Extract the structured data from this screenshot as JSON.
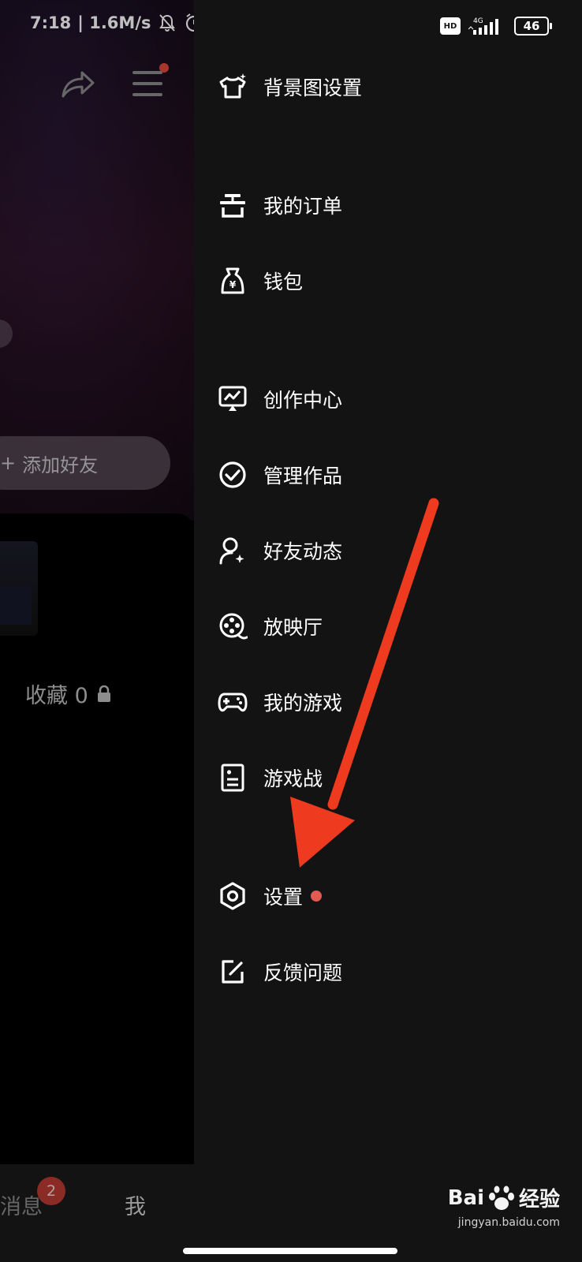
{
  "status_bar": {
    "time": "7:18",
    "net_speed": "| 1.6M/s",
    "network": "4G",
    "hd": "HD",
    "battery": "46"
  },
  "background_page": {
    "add_friend_label": "添加好友",
    "collect_label": "收藏 0",
    "tabbar": {
      "messages_label": "消息",
      "messages_badge": "2",
      "me_label": "我"
    }
  },
  "drawer": {
    "items": [
      {
        "label": "背景图设置",
        "icon": "tshirt-icon"
      },
      {
        "label": "我的订单",
        "icon": "order-icon"
      },
      {
        "label": "钱包",
        "icon": "wallet-icon"
      },
      {
        "label": "创作中心",
        "icon": "creator-icon"
      },
      {
        "label": "管理作品",
        "icon": "check-circle-icon"
      },
      {
        "label": "好友动态",
        "icon": "friend-activity-icon"
      },
      {
        "label": "放映厅",
        "icon": "film-reel-icon"
      },
      {
        "label": "我的游戏",
        "icon": "gamepad-icon"
      },
      {
        "label": "游戏战",
        "icon": "game-record-icon"
      },
      {
        "label": "设置",
        "icon": "settings-hex-icon",
        "has_dot": true
      },
      {
        "label": "反馈问题",
        "icon": "feedback-edit-icon"
      }
    ]
  },
  "watermark": {
    "brand_left": "Bai",
    "brand_right": "经验",
    "url": "jingyan.baidu.com"
  },
  "colors": {
    "drawer_bg": "#131313",
    "annotation_arrow": "#ee3a1e",
    "notification_dot": "#e25a52"
  }
}
